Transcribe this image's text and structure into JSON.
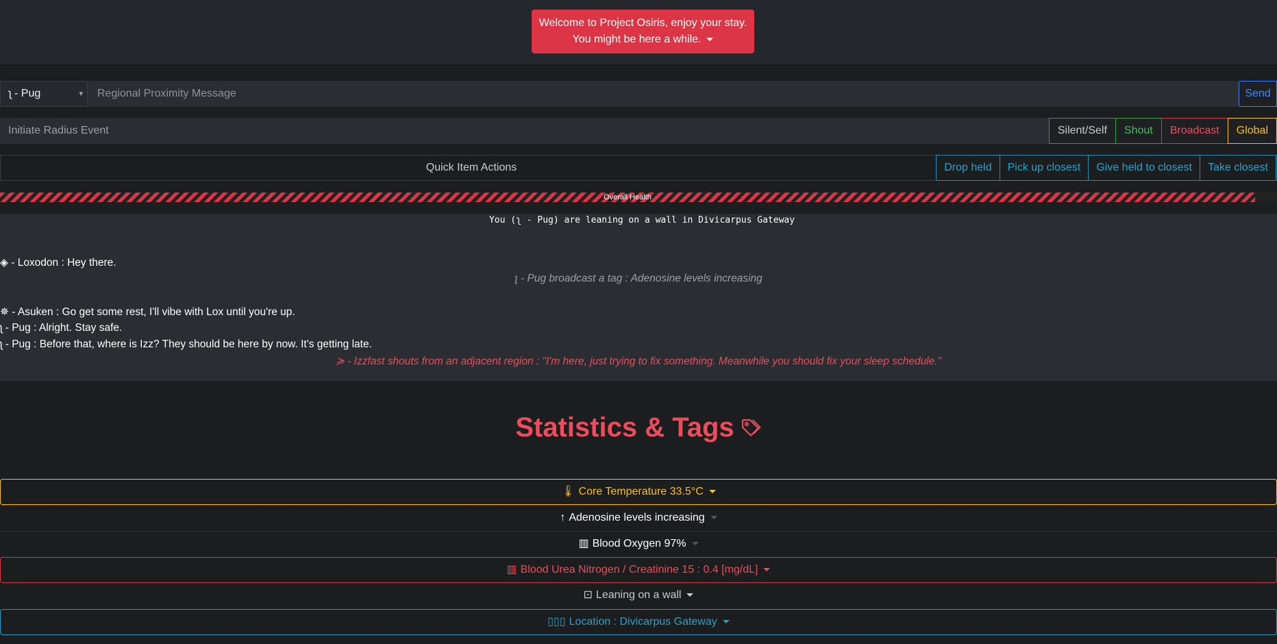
{
  "welcome": {
    "line1": "Welcome to Project Osiris, enjoy your stay.",
    "line2": "You might be here a while."
  },
  "message": {
    "character_select": "ʅ - Pug",
    "placeholder": "Regional Proximity Message",
    "send_label": "Send"
  },
  "radius": {
    "placeholder": "Initiate Radius Event",
    "buttons": [
      "Silent/Self",
      "Shout",
      "Broadcast",
      "Global"
    ]
  },
  "quick_items": {
    "title": "Quick Item Actions",
    "buttons": [
      "Drop held",
      "Pick up closest",
      "Give held to closest",
      "Take closest"
    ]
  },
  "health": {
    "label": "Overall Health",
    "level": 0.983,
    "color": "#dc3545"
  },
  "chat": {
    "status": "You (ʅ - Pug) are leaning on a wall in Divicarpus Gateway",
    "messages": [
      "◈ - Loxodon : Hey there.",
      "ʅ - Pug broadcast a tag : Adenosine levels increasing",
      "✵ - Asuken : Go get some rest, I'll vibe with Lox until you're up.",
      "ʅ - Pug : Alright. Stay safe.",
      "ʅ - Pug : Before that, where is Izz? They should be here by now. It's getting late.",
      "≽ - Izzfast shouts from an adjacent region : \"I'm here, just trying to fix something. Meanwhile you should fix your sleep schedule.\""
    ]
  },
  "stats": {
    "title": "Statistics & Tags",
    "items": [
      "Core Temperature 33.5°C",
      "Adenosine levels increasing",
      "Blood Oxygen 97%",
      "Blood Urea Nitrogen / Creatinine 15 : 0.4 [mg/dL]",
      "Leaning on a wall",
      "Location : Divicarpus Gateway"
    ],
    "icons": [
      "thermometer-icon",
      "arrow-up-icon",
      "chart-icon",
      "chart-icon",
      "dropdown-box-icon",
      "map-icon"
    ]
  },
  "colors": {
    "danger": "#dc3545",
    "warning": "#ffc107",
    "info": "#1b9bc9",
    "success": "#28a745",
    "primary": "#3d8bfd"
  }
}
